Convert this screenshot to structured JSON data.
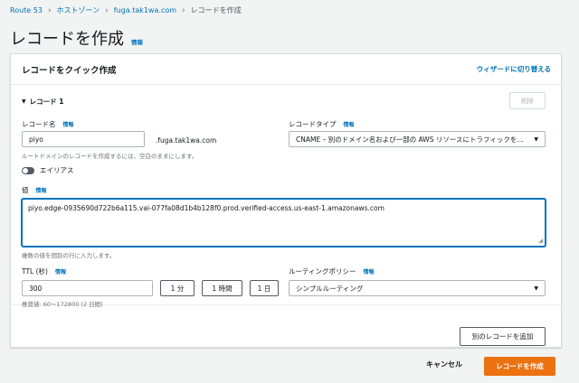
{
  "breadcrumb": {
    "items": [
      "Route 53",
      "ホストゾーン",
      "fuga.tak1wa.com"
    ],
    "current": "レコードを作成"
  },
  "page": {
    "title": "レコードを作成",
    "info": "情報"
  },
  "panel": {
    "title": "レコードをクイック作成",
    "wizard_link": "ウィザードに切り替える"
  },
  "record": {
    "heading": "レコード 1",
    "delete_label": "削除",
    "name": {
      "label": "レコード名",
      "info": "情報",
      "value": "piyo",
      "suffix": ".fuga.tak1wa.com",
      "hint": "ルートドメインのレコードを作成するには、空白のままにします。"
    },
    "type": {
      "label": "レコードタイプ",
      "info": "情報",
      "value": "CNAME – 別のドメイン名および一部の AWS リソースにトラフィックを..."
    },
    "alias": {
      "label": "エイリアス",
      "enabled": false
    },
    "value": {
      "label": "値",
      "info": "情報",
      "text": "piyo.edge-0935690d722b6a115.vai-077fa08d1b4b128f0.prod.verified-access.us-east-1.amazonaws.com",
      "hint": "複数の値を個別の行に入力します。"
    },
    "ttl": {
      "label": "TTL (秒)",
      "info": "情報",
      "value": "300",
      "presets": [
        "1 分",
        "1 時間",
        "1 日"
      ],
      "hint": "推奨値: 60〜172800 (2 日間)"
    },
    "routing": {
      "label": "ルーティングポリシー",
      "info": "情報",
      "value": "シンプルルーティング"
    }
  },
  "add_record_label": "別のレコードを追加",
  "footer": {
    "cancel_label": "キャンセル",
    "create_label": "レコードを作成"
  },
  "colors": {
    "accent": "#ec7211",
    "link": "#0073bb",
    "background": "#f2f3f3"
  }
}
